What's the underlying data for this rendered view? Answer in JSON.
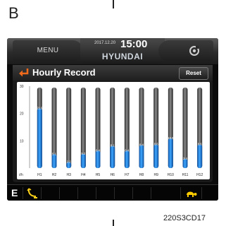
{
  "figure": {
    "section_letter": "B",
    "caption": "220S3CD17"
  },
  "topbar": {
    "menu_label": "MENU",
    "date": "2017.12.20",
    "time": "15:00",
    "brand": "HYUNDAI",
    "right_icon": "gear-icon"
  },
  "panel": {
    "back_icon": "back-arrow-icon",
    "title": "Hourly Record",
    "reset_label": "Reset"
  },
  "bottombar": {
    "mode_label": "E",
    "icons": [
      "work-lever-icon",
      "turtle-icon"
    ]
  },
  "colors": {
    "accent_orange": "#f06a1c",
    "bar_blue": "#1a7fe0",
    "lever_yellow": "#ffd21a",
    "turtle_yellow": "#ffcc00"
  },
  "chart_data": {
    "type": "bar",
    "title": "",
    "xlabel": "",
    "ylabel": "",
    "y_unit_label": "ℓ/h",
    "ylim": [
      0,
      30
    ],
    "yticks": [
      10,
      20,
      30
    ],
    "categories": [
      "H1",
      "H2",
      "H3",
      "H4",
      "H5",
      "H6",
      "H7",
      "H8",
      "H9",
      "H10",
      "H11",
      "H12"
    ],
    "values": [
      21.9,
      5.1,
      2.2,
      5.2,
      6.4,
      8.1,
      6.4,
      8.4,
      8.6,
      10.9,
      3.4,
      8.6
    ],
    "value_labels": [
      "21.9",
      "5.1",
      "2.2",
      "5.2",
      "6.4",
      "8.1",
      "6.4",
      "8.4",
      "8.6",
      "10.9",
      "3.4",
      "8.6"
    ],
    "grid": false,
    "legend": "none"
  }
}
